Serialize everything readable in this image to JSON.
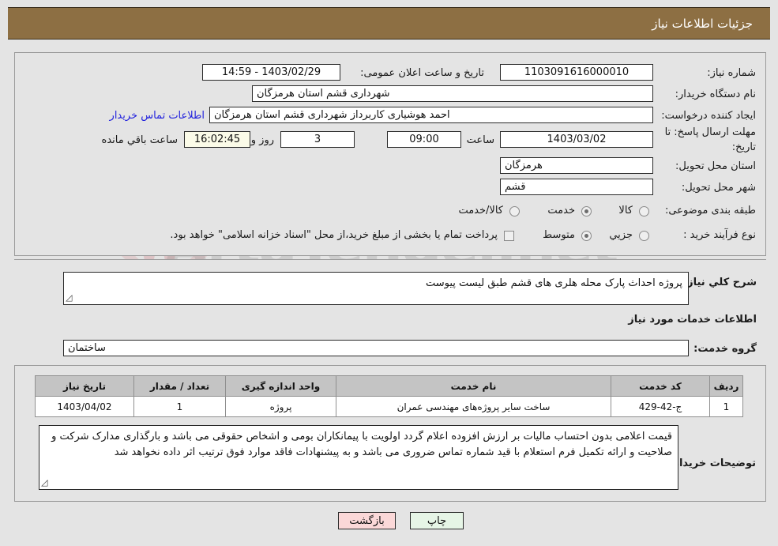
{
  "header": {
    "title": "جزئیات اطلاعات نیاز"
  },
  "top_form": {
    "need_number": {
      "label": "شماره نیاز:",
      "value": "1103091616000010"
    },
    "announce_datetime": {
      "label": "تاریخ و ساعت اعلان عمومی:",
      "value": "1403/02/29 - 14:59"
    },
    "buyer_org": {
      "label": "نام دستگاه خریدار:",
      "value": "شهرداری قشم استان هرمزگان"
    },
    "requester": {
      "label": "ایجاد کننده درخواست:",
      "value": "احمد هوشیاری کاربرداز شهرداری قشم استان هرمزگان"
    },
    "buyer_contact_link": "اطلاعات تماس خریدار",
    "deadline": {
      "label": "مهلت ارسال پاسخ: تا تاریخ:",
      "date": "1403/03/02",
      "time_label": "ساعت",
      "time": "09:00",
      "days": "3",
      "days_suffix": "روز و",
      "countdown": "16:02:45",
      "countdown_suffix": "ساعت باقي مانده"
    },
    "province": {
      "label": "استان محل تحویل:",
      "value": "هرمزگان"
    },
    "city": {
      "label": "شهر محل تحویل:",
      "value": "قشم"
    },
    "category": {
      "label": "طبقه بندی موضوعی:",
      "options": [
        "کالا",
        "خدمت",
        "کالا/خدمت"
      ],
      "selected": "خدمت"
    },
    "purchase_type": {
      "label": "نوع فرآیند خرید :",
      "options": [
        "جزیي",
        "متوسط"
      ],
      "selected": "متوسط",
      "checkbox_label": "پرداخت تمام یا بخشی از مبلغ خرید،از محل \"اسناد خزانه اسلامی\" خواهد بود.",
      "checkbox_checked": false
    }
  },
  "middle": {
    "general_desc": {
      "label": "شرح کلي نیاز:",
      "value": "پروژه احداث پارک محله هلری های قشم طبق لیست پیوست"
    },
    "section_title": "اطلاعات خدمات مورد نیاز",
    "service_group": {
      "label": "گروه خدمت:",
      "value": "ساختمان"
    }
  },
  "table": {
    "columns": [
      "ردیف",
      "کد خدمت",
      "نام خدمت",
      "واحد اندازه گیری",
      "تعداد / مقدار",
      "تاریخ نیاز"
    ],
    "rows": [
      {
        "row_no": "1",
        "service_code": "ج-42-429",
        "service_name": "ساخت سایر پروژه‌های مهندسی عمران",
        "unit": "پروژه",
        "quantity": "1",
        "need_date": "1403/04/02"
      }
    ]
  },
  "buyer_notes": {
    "label": "توضیحات خریدار:",
    "value": "قیمت اعلامی بدون احتساب مالیات بر ارزش افزوده اعلام گردد اولویت با پیمانکاران بومی و اشخاص حقوقی می باشد و بارگذاری مدارک شرکت و صلاحیت و ارائه تکمیل فرم استعلام با قید شماره تماس ضروری می باشد و به پیشنهادات فاقد موارد فوق ترتیب اثر داده نخواهد شد"
  },
  "footer": {
    "print_button": "چاپ",
    "back_button": "بازگشت"
  },
  "watermark": {
    "text": "ArtaTender.net"
  },
  "colors": {
    "titlebar_bg": "#8d6f43",
    "page_bg": "#e4e4e4",
    "link": "#2222dd",
    "print_btn": "#e6f5e6",
    "back_btn": "#fbd8d8",
    "countdown_bg": "#fbfbe8",
    "table_header_bg": "#c4c4c4"
  }
}
